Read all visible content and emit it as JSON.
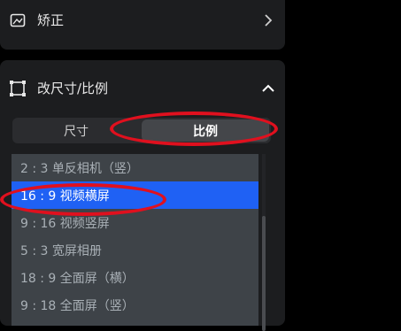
{
  "sections": {
    "correction": {
      "label": "矫正",
      "icon": "crop-correct-icon",
      "chevron": "chevron-right-icon"
    },
    "resize": {
      "label": "改尺寸/比例",
      "icon": "resize-frame-icon",
      "chevron": "chevron-up-icon"
    }
  },
  "tabs": [
    {
      "label": "尺寸",
      "active": false
    },
    {
      "label": "比例",
      "active": true
    }
  ],
  "ratio_list": [
    {
      "label": "2 : 3 单反相机（竖）",
      "selected": false
    },
    {
      "label": "16 : 9 视频横屏",
      "selected": true
    },
    {
      "label": "9 : 16 视频竖屏",
      "selected": false
    },
    {
      "label": "5 : 3 宽屏相册",
      "selected": false
    },
    {
      "label": "18 : 9 全面屏（横）",
      "selected": false
    },
    {
      "label": "9 : 18 全面屏（竖）",
      "selected": false
    }
  ],
  "colors": {
    "panel": "#1c1d1f",
    "selected": "#1f61f4",
    "annotation": "#e0101e"
  }
}
